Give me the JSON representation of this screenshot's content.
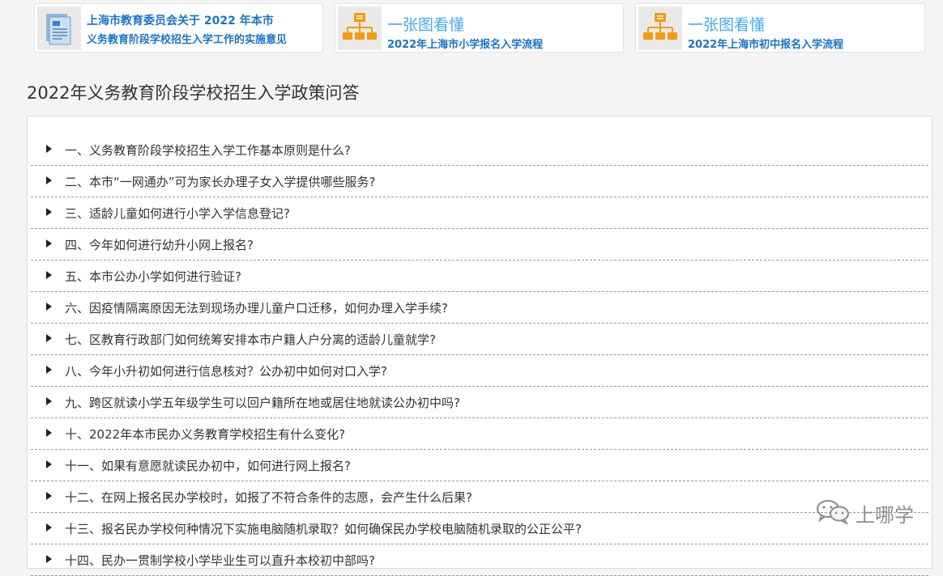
{
  "cards": [
    {
      "line1": "上海市教育委员会关于 2022 年本市",
      "line2": "义务教育阶段学校招生入学工作的实施意见",
      "icon": "document-icon"
    },
    {
      "title": "一张图看懂",
      "subtitle": "2022年上海市小学报名入学流程",
      "icon": "org-chart-icon"
    },
    {
      "title": "一张图看懂",
      "subtitle": "2022年上海市初中报名入学流程",
      "icon": "org-chart-icon"
    }
  ],
  "section_title": "2022年义务教育阶段学校招生入学政策问答",
  "faq": [
    "一、义务教育阶段学校招生入学工作基本原则是什么?",
    "二、本市“一网通办”可为家长办理子女入学提供哪些服务?",
    "三、适龄儿童如何进行小学入学信息登记?",
    "四、今年如何进行幼升小网上报名?",
    "五、本市公办小学如何进行验证?",
    "六、因疫情隔离原因无法到现场办理儿童户口迁移，如何办理入学手续?",
    "七、区教育行政部门如何统筹安排本市户籍人户分离的适龄儿童就学?",
    "八、今年小升初如何进行信息核对？公办初中如何对口入学?",
    "九、跨区就读小学五年级学生可以回户籍所在地或居住地就读公办初中吗?",
    "十、2022年本市民办义务教育学校招生有什么变化?",
    "十一、如果有意愿就读民办初中，如何进行网上报名?",
    "十二、在网上报名民办学校时，如报了不符合条件的志愿，会产生什么后果?",
    "十三、报名民办学校何种情况下实施电脑随机录取？如何确保民办学校电脑随机录取的公正公平?",
    "十四、民办一贯制学校小学毕业生可以直升本校初中部吗?"
  ],
  "watermark": {
    "text": "上哪学",
    "icon": "wechat-icon"
  },
  "colors": {
    "accent": "#1a73c9",
    "light_accent": "#45aaf2",
    "icon_orange": "#f39c12"
  }
}
